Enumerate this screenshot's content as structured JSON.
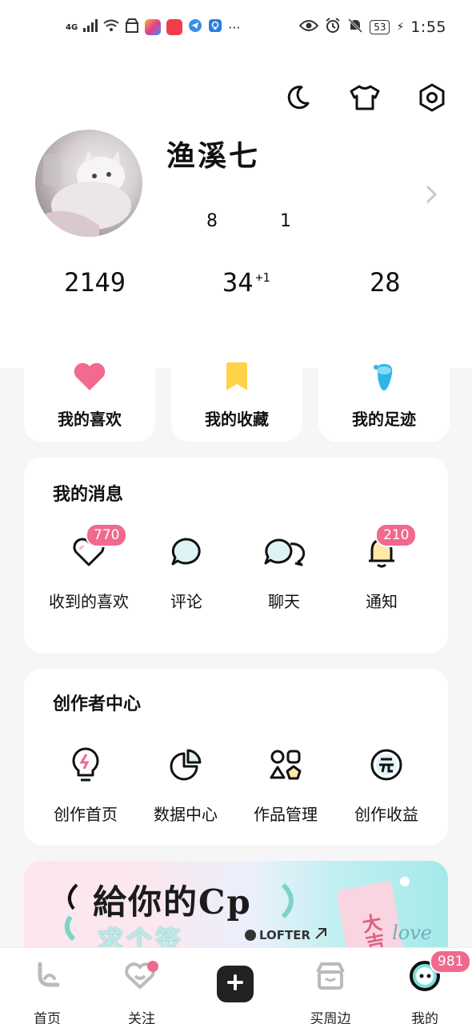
{
  "status_bar": {
    "network": "4G",
    "battery": "53",
    "time": "1:55"
  },
  "header": {
    "icons": [
      "moon-icon",
      "shirt-icon",
      "settings-icon"
    ]
  },
  "profile": {
    "username": "渔溪七",
    "small_counts": [
      "8",
      "1"
    ],
    "stats": [
      {
        "value": "2149",
        "sup": ""
      },
      {
        "value": "34",
        "sup": "+1"
      },
      {
        "value": "28",
        "sup": ""
      }
    ]
  },
  "quick": [
    {
      "label": "我的喜欢",
      "icon": "heart-icon",
      "color": "#f26a8e"
    },
    {
      "label": "我的收藏",
      "icon": "bookmark-icon",
      "color": "#ffd24a"
    },
    {
      "label": "我的足迹",
      "icon": "footprint-icon",
      "color": "#2fb6e8"
    }
  ],
  "messages": {
    "title": "我的消息",
    "items": [
      {
        "label": "收到的喜欢",
        "icon": "heart-outline-icon",
        "badge": "770"
      },
      {
        "label": "评论",
        "icon": "comment-icon",
        "badge": ""
      },
      {
        "label": "聊天",
        "icon": "chat-icon",
        "badge": ""
      },
      {
        "label": "通知",
        "icon": "bell-icon",
        "badge": "210"
      }
    ]
  },
  "creator": {
    "title": "创作者中心",
    "items": [
      {
        "label": "创作首页",
        "icon": "bulb-icon"
      },
      {
        "label": "数据中心",
        "icon": "pie-chart-icon"
      },
      {
        "label": "作品管理",
        "icon": "apps-icon"
      },
      {
        "label": "创作收益",
        "icon": "yuan-icon"
      }
    ]
  },
  "banner": {
    "title": "給你的Cp",
    "subtitle": "求个签",
    "brand": "LOFTER",
    "tag": "大吉",
    "love": "love"
  },
  "nav": {
    "items": [
      {
        "label": "首页",
        "icon": "home-icon"
      },
      {
        "label": "关注",
        "icon": "follow-icon"
      },
      {
        "label": "买周边",
        "icon": "shop-icon"
      },
      {
        "label": "我的",
        "icon": "me-icon",
        "badge": "981"
      }
    ]
  }
}
